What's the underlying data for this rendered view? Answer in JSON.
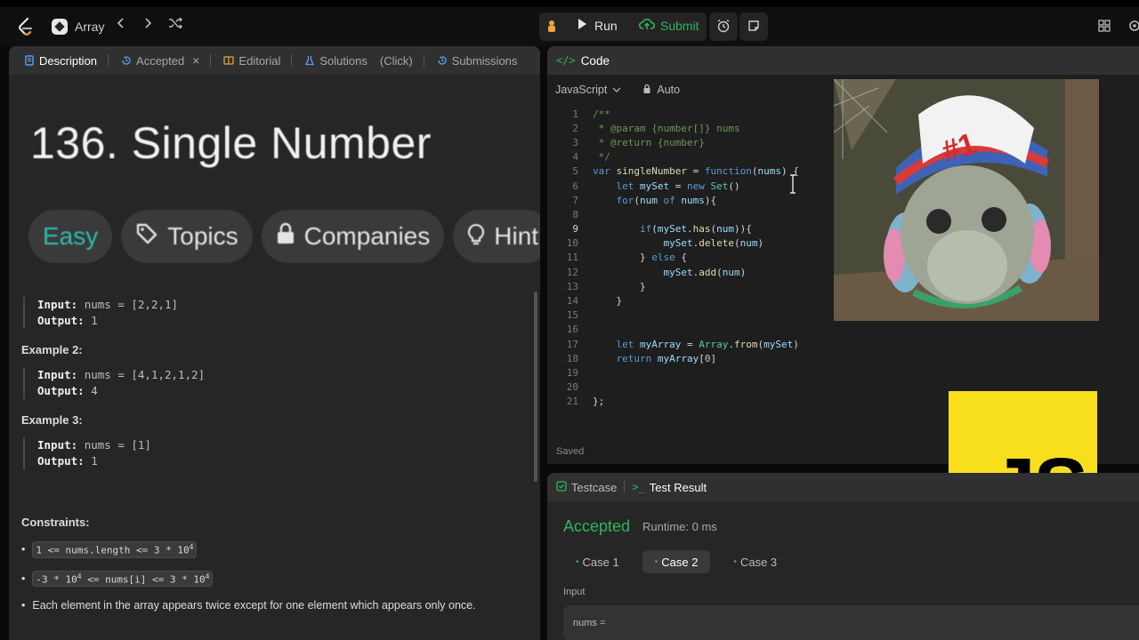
{
  "topbar": {
    "problem_list_label": "Array",
    "run_label": "Run",
    "submit_label": "Submit"
  },
  "description_tabs": [
    {
      "label": "Description"
    },
    {
      "label": "Accepted"
    },
    {
      "label": "Editorial"
    },
    {
      "label": "Solutions"
    },
    {
      "label": "(Click)"
    },
    {
      "label": "Submissions"
    }
  ],
  "problem": {
    "title": "136. Single Number",
    "chips": {
      "difficulty": "Easy",
      "topics": "Topics",
      "companies": "Companies",
      "hint": "Hint"
    },
    "example1": {
      "input_label": "Input:",
      "input_value": "nums = [2,2,1]",
      "output_label": "Output:",
      "output_value": "1"
    },
    "example2": {
      "title": "Example 2:",
      "input_label": "Input:",
      "input_value": "nums = [4,1,2,1,2]",
      "output_label": "Output:",
      "output_value": "4"
    },
    "example3": {
      "title": "Example 3:",
      "input_label": "Input:",
      "input_value": "nums = [1]",
      "output_label": "Output:",
      "output_value": "1"
    },
    "constraints_title": "Constraints:",
    "constraints": {
      "c1": "1 <= nums.length <= 3 * 10",
      "c1_sup": "4",
      "c2_pre": "-3 * 10",
      "c2_sup1": "4",
      "c2_mid": " <= nums[i] <= 3 * 10",
      "c2_sup2": "4",
      "c3": "Each element in the array appears twice except for one element which appears only once."
    }
  },
  "code_panel": {
    "header": "Code",
    "language": "JavaScript",
    "mode": "Auto",
    "status": "Saved"
  },
  "code_lines": [
    "/**",
    " * @param {number[]} nums",
    " * @return {number}",
    " */",
    "var singleNumber = function(nums) {",
    "    let mySet = new Set()",
    "    for(num of nums){",
    "",
    "        if(mySet.has(num)){",
    "            mySet.delete(num)",
    "        } else {",
    "            mySet.add(num)",
    "        }",
    "    }",
    "",
    "",
    "    let myArray = Array.from(mySet)",
    "    return myArray[0]",
    "",
    "",
    "};"
  ],
  "overlay": {
    "js_logo_text": "JS",
    "meme_cap_text": "#1"
  },
  "test_panel": {
    "tab_testcase": "Testcase",
    "tab_result": "Test Result",
    "status": "Accepted",
    "runtime": "Runtime: 0 ms",
    "cases": [
      "Case 1",
      "Case 2",
      "Case 3"
    ],
    "active_case": 1,
    "input_label": "Input",
    "input_value": "nums ="
  },
  "colors": {
    "accent_green": "#2db55d",
    "easy_teal": "#2cbbb0",
    "js_yellow": "#f7df1e"
  }
}
